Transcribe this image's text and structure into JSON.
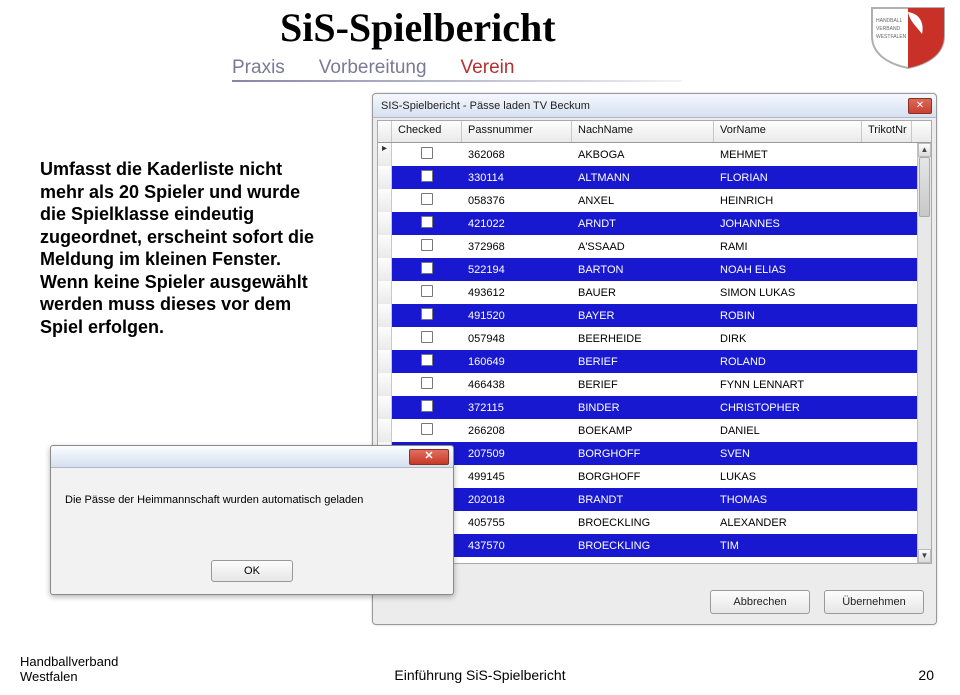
{
  "header": {
    "title": "SiS-Spielbericht",
    "nav": {
      "praxis": "Praxis",
      "vorbereitung": "Vorbereitung",
      "verein": "Verein"
    },
    "logo": {
      "top": "HANDBALL",
      "mid": "VERBAND",
      "bot": "WESTFALEN"
    }
  },
  "left_paragraph": "Umfasst die Kaderliste nicht mehr als 20 Spieler und wurde die Spielklasse eindeutig zugeordnet, erscheint sofort die Meldung im kleinen Fenster. Wenn keine Spieler ausgewählt werden muss dieses vor dem Spiel erfolgen.",
  "window": {
    "title": "SIS-Spielbericht - Pässe laden TV Beckum",
    "columns": {
      "checked": "Checked",
      "passnummer": "Passnummer",
      "nachname": "NachName",
      "vorname": "VorName",
      "trikotnr": "TrikotNr"
    },
    "rows": [
      {
        "pass": "362068",
        "nach": "AKBOGA",
        "vorn": "MEHMET"
      },
      {
        "pass": "330114",
        "nach": "ALTMANN",
        "vorn": "FLORIAN"
      },
      {
        "pass": "058376",
        "nach": "ANXEL",
        "vorn": "HEINRICH"
      },
      {
        "pass": "421022",
        "nach": "ARNDT",
        "vorn": "JOHANNES"
      },
      {
        "pass": "372968",
        "nach": "A'SSAAD",
        "vorn": "RAMI"
      },
      {
        "pass": "522194",
        "nach": "BARTON",
        "vorn": "NOAH ELIAS"
      },
      {
        "pass": "493612",
        "nach": "BAUER",
        "vorn": "SIMON LUKAS"
      },
      {
        "pass": "491520",
        "nach": "BAYER",
        "vorn": "ROBIN"
      },
      {
        "pass": "057948",
        "nach": "BEERHEIDE",
        "vorn": "DIRK"
      },
      {
        "pass": "160649",
        "nach": "BERIEF",
        "vorn": "ROLAND"
      },
      {
        "pass": "466438",
        "nach": "BERIEF",
        "vorn": "FYNN LENNART"
      },
      {
        "pass": "372115",
        "nach": "BINDER",
        "vorn": "CHRISTOPHER"
      },
      {
        "pass": "266208",
        "nach": "BOEKAMP",
        "vorn": "DANIEL"
      },
      {
        "pass": "207509",
        "nach": "BORGHOFF",
        "vorn": "SVEN"
      },
      {
        "pass": "499145",
        "nach": "BORGHOFF",
        "vorn": "LUKAS"
      },
      {
        "pass": "202018",
        "nach": "BRANDT",
        "vorn": "THOMAS"
      },
      {
        "pass": "405755",
        "nach": "BROECKLING",
        "vorn": "ALEXANDER"
      },
      {
        "pass": "437570",
        "nach": "BROECKLING",
        "vorn": "TIM"
      }
    ],
    "buttons": {
      "abbrechen": "Abbrechen",
      "uebernehmen": "Übernehmen"
    }
  },
  "message_dialog": {
    "text": "Die Pässe der Heimmannschaft wurden automatisch geladen",
    "ok": "OK"
  },
  "footer": {
    "left1": "Handballverband",
    "left2": "Westfalen",
    "center": "Einführung SiS-Spielbericht",
    "page": "20"
  }
}
